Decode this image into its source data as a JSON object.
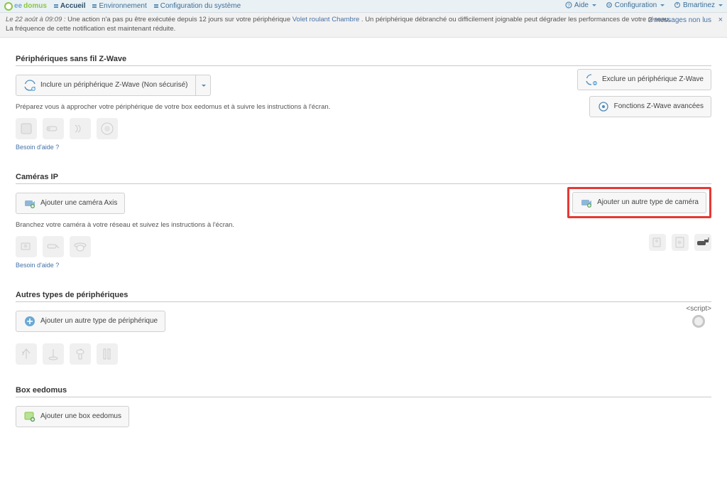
{
  "topbar": {
    "brand_ee": "ee",
    "brand_domus": "domus",
    "nav_home": "Accueil",
    "nav_env": "Environnement",
    "nav_config": "Configuration du système",
    "help": "Aide",
    "config_menu": "Configuration",
    "user": "Bmartinez"
  },
  "notif": {
    "date_prefix": "Le 22 août à 09:09 :",
    "line1_a": " Une action n'a pas pu être exécutée depuis 12 jours sur votre périphérique ",
    "device_link": "Volet roulant Chambre",
    "line1_b": ". Un périphérique débranché ou difficilement joignable peut dégrader les performances de votre réseau.",
    "line2": "La fréquence de cette notification est maintenant réduite.",
    "msgcount": "2 messages non lus",
    "close": "×"
  },
  "sections": {
    "zwave": {
      "title": "Périphériques sans fil Z-Wave",
      "include_label": "Inclure un périphérique Z-Wave (Non sécurisé)",
      "hint": "Préparez vous à approcher votre périphérique de votre box eedomus et à suivre les instructions à l'écran.",
      "help": "Besoin d'aide ?",
      "exclude_label": "Exclure un périphérique Z-Wave",
      "advanced_label": "Fonctions Z-Wave avancées"
    },
    "cameras": {
      "title": "Caméras IP",
      "add_axis": "Ajouter une caméra Axis",
      "hint": "Branchez votre caméra à votre réseau et suivez les instructions à l'écran.",
      "help": "Besoin d'aide ?",
      "add_other": "Ajouter un autre type de caméra"
    },
    "other": {
      "title": "Autres types de périphériques",
      "add_other": "Ajouter un autre type de périphérique",
      "script_label": "<script>"
    },
    "box": {
      "title": "Box eedomus",
      "add_box": "Ajouter une box eedomus"
    }
  }
}
